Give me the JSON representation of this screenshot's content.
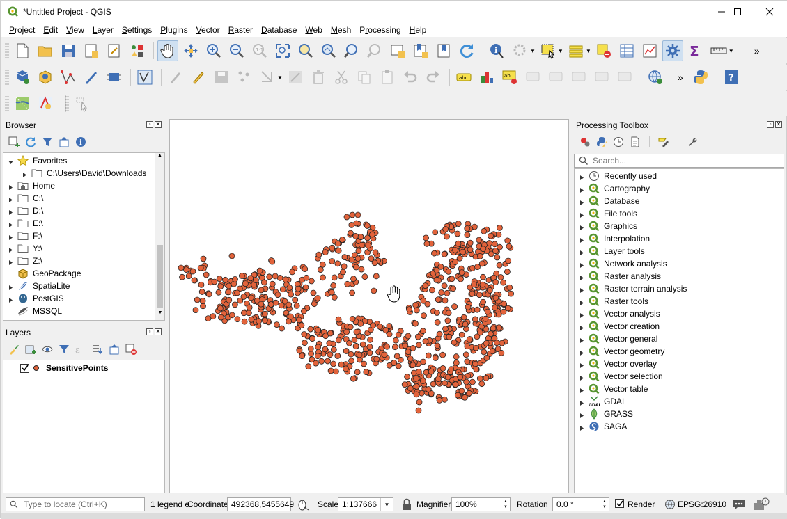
{
  "window": {
    "title": "*Untitled Project - QGIS",
    "controls": {
      "minimize": "—",
      "maximize": "☐",
      "close": "✕"
    }
  },
  "menu": [
    "Project",
    "Edit",
    "View",
    "Layer",
    "Settings",
    "Plugins",
    "Vector",
    "Raster",
    "Database",
    "Web",
    "Mesh",
    "Processing",
    "Help"
  ],
  "menu_mnemonics": [
    "P",
    "E",
    "V",
    "L",
    "S",
    "P",
    "V",
    "R",
    "D",
    "W",
    "M",
    "r",
    "H"
  ],
  "browser": {
    "title": "Browser",
    "items": [
      {
        "label": "Favorites",
        "icon": "star-icon",
        "expanded": true
      },
      {
        "label": "C:\\Users\\David\\Downloads",
        "icon": "folder-icon",
        "indent": 1
      },
      {
        "label": "Home",
        "icon": "home-folder-icon"
      },
      {
        "label": "C:\\",
        "icon": "folder-icon"
      },
      {
        "label": "D:\\",
        "icon": "folder-icon"
      },
      {
        "label": "E:\\",
        "icon": "folder-icon"
      },
      {
        "label": "F:\\",
        "icon": "folder-icon"
      },
      {
        "label": "Y:\\",
        "icon": "folder-icon"
      },
      {
        "label": "Z:\\",
        "icon": "folder-icon"
      },
      {
        "label": "GeoPackage",
        "icon": "geopackage-icon"
      },
      {
        "label": "SpatiaLite",
        "icon": "spatialite-icon"
      },
      {
        "label": "PostGIS",
        "icon": "postgis-icon"
      },
      {
        "label": "MSSQL",
        "icon": "mssql-icon"
      }
    ]
  },
  "layers": {
    "title": "Layers",
    "items": [
      {
        "label": "SensitivePoints",
        "checked": true,
        "color": "#e2633b"
      }
    ]
  },
  "toolbox": {
    "title": "Processing Toolbox",
    "search_placeholder": "Search...",
    "items": [
      {
        "label": "Recently used",
        "icon": "clock-icon"
      },
      {
        "label": "Cartography",
        "icon": "qgis-icon"
      },
      {
        "label": "Database",
        "icon": "qgis-icon"
      },
      {
        "label": "File tools",
        "icon": "qgis-icon"
      },
      {
        "label": "Graphics",
        "icon": "qgis-icon"
      },
      {
        "label": "Interpolation",
        "icon": "qgis-icon"
      },
      {
        "label": "Layer tools",
        "icon": "qgis-icon"
      },
      {
        "label": "Network analysis",
        "icon": "qgis-icon"
      },
      {
        "label": "Raster analysis",
        "icon": "qgis-icon"
      },
      {
        "label": "Raster terrain analysis",
        "icon": "qgis-icon"
      },
      {
        "label": "Raster tools",
        "icon": "qgis-icon"
      },
      {
        "label": "Vector analysis",
        "icon": "qgis-icon"
      },
      {
        "label": "Vector creation",
        "icon": "qgis-icon"
      },
      {
        "label": "Vector general",
        "icon": "qgis-icon"
      },
      {
        "label": "Vector geometry",
        "icon": "qgis-icon"
      },
      {
        "label": "Vector overlay",
        "icon": "qgis-icon"
      },
      {
        "label": "Vector selection",
        "icon": "qgis-icon"
      },
      {
        "label": "Vector table",
        "icon": "qgis-icon"
      },
      {
        "label": "GDAL",
        "icon": "gdal-icon"
      },
      {
        "label": "GRASS",
        "icon": "grass-icon"
      },
      {
        "label": "SAGA",
        "icon": "saga-icon"
      }
    ]
  },
  "status": {
    "locate_placeholder": "Type to locate (Ctrl+K)",
    "legend_text": "1 legend e",
    "coordinate_label": "Coordinate",
    "coordinate_value": "492368,5455649",
    "scale_label": "Scale",
    "scale_value": "1:137666",
    "magnifier_label": "Magnifier",
    "magnifier_value": "100%",
    "rotation_label": "Rotation",
    "rotation_value": "0.0 °",
    "render_label": "Render",
    "render_checked": true,
    "crs": "EPSG:26910"
  },
  "colors": {
    "accent": "#589632",
    "point_fill": "#e2633b",
    "point_stroke": "#232323"
  }
}
